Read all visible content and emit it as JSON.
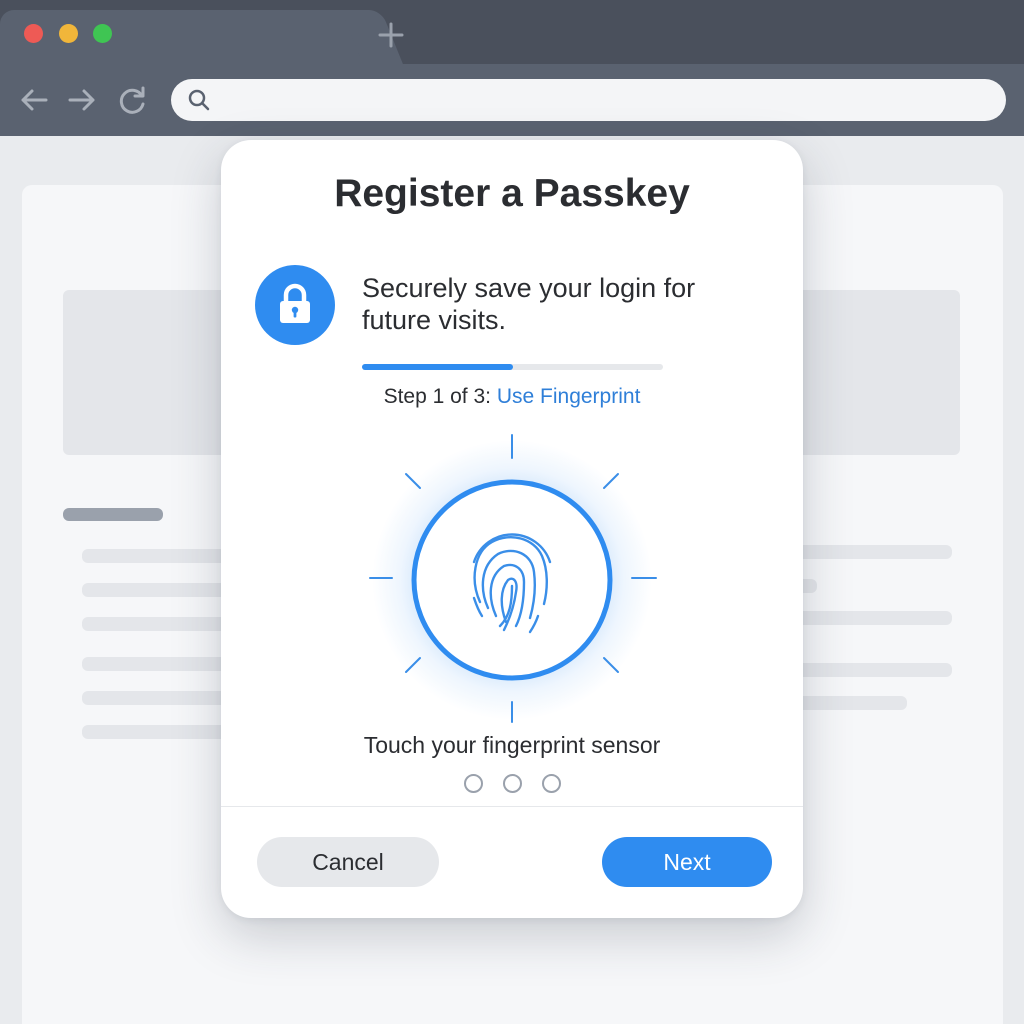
{
  "browser": {
    "new_tab_icon": "plus-icon",
    "nav_icons": [
      "back-arrow-icon",
      "forward-arrow-icon",
      "reload-icon"
    ],
    "url_search_icon": "search-icon",
    "url_value": ""
  },
  "dialog": {
    "title": "Register a Passkey",
    "badge_icon": "lock-icon",
    "subtitle": "Securely save your login for future visits.",
    "progress_fraction": 0.5,
    "step_prefix": "Step 1 of 3:",
    "step_label": "Use Fingerprint",
    "sensor_icon": "fingerprint-icon",
    "instruction": "Touch your fingerprint sensor",
    "page_dots": 3,
    "cancel_label": "Cancel",
    "next_label": "Next"
  },
  "colors": {
    "accent": "#2f8cf0",
    "step_link": "#2f7fd8",
    "chrome": "#5a6270"
  }
}
